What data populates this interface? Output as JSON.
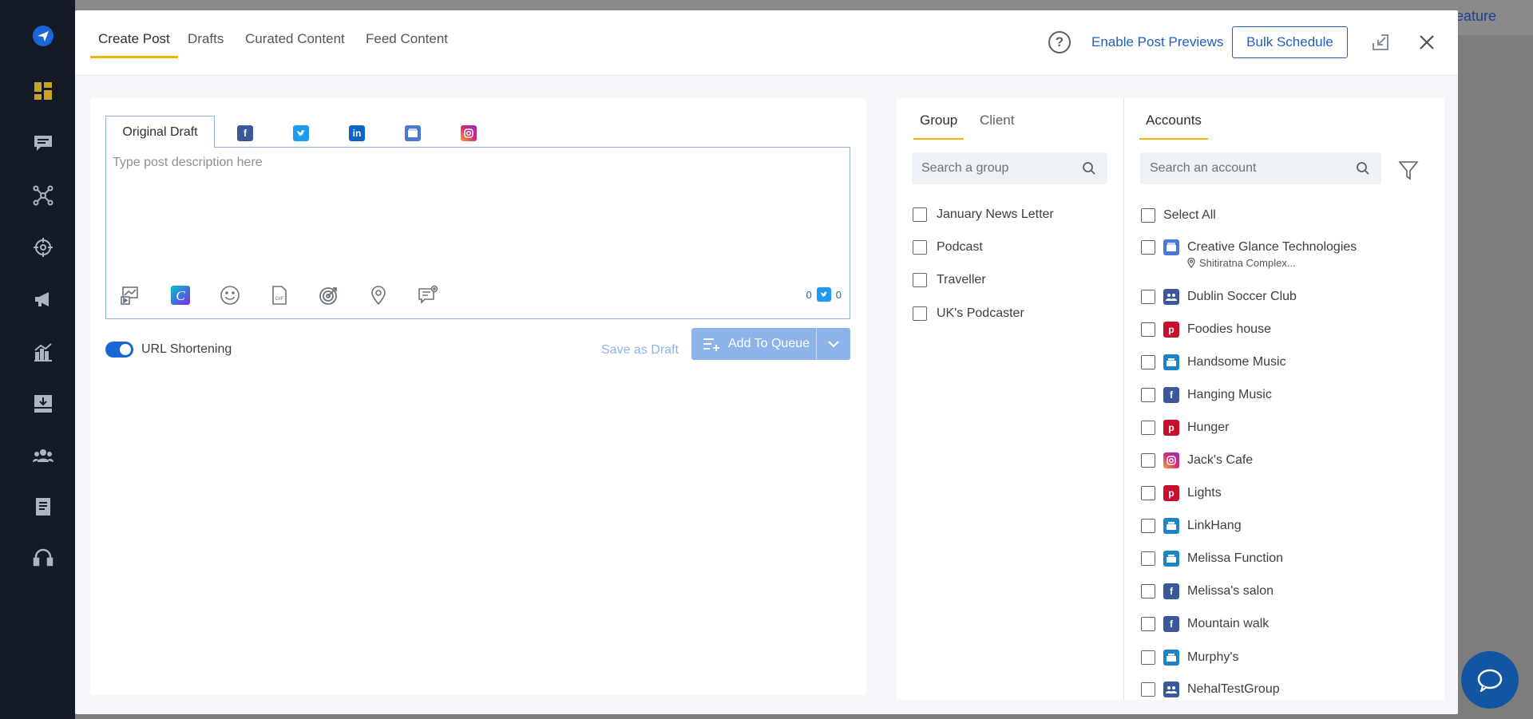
{
  "background": {
    "feature_text": "eature"
  },
  "header": {
    "tabs": [
      {
        "label": "Create Post"
      },
      {
        "label": "Drafts"
      },
      {
        "label": "Curated Content"
      },
      {
        "label": "Feed Content"
      }
    ],
    "help": "?",
    "enable_previews": "Enable Post Previews",
    "bulk_schedule": "Bulk Schedule"
  },
  "compose": {
    "original_tab": "Original Draft",
    "network_tabs": [
      "facebook-icon",
      "twitter-icon",
      "linkedin-icon",
      "google-business-icon",
      "instagram-icon"
    ],
    "placeholder": "Type post description here",
    "counter_left": "0",
    "counter_right": "0",
    "url_shortening": "URL Shortening",
    "save_draft": "Save as Draft",
    "add_to_queue": "Add To Queue"
  },
  "groups": {
    "tabs": [
      {
        "label": "Group"
      },
      {
        "label": "Client"
      }
    ],
    "search_placeholder": "Search a group",
    "items": [
      {
        "label": "January News Letter"
      },
      {
        "label": "Podcast"
      },
      {
        "label": "Traveller"
      },
      {
        "label": "UK's Podcaster"
      }
    ]
  },
  "accounts": {
    "tab": "Accounts",
    "search_placeholder": "Search an account",
    "select_all": "Select All",
    "items": [
      {
        "label": "Creative Glance Technologies",
        "sub": "Shitiratna Complex...",
        "network": "google-business",
        "color": "#4a78d6"
      },
      {
        "label": "Dublin Soccer Club",
        "network": "facebook-group",
        "color": "#3b5998"
      },
      {
        "label": "Foodies house",
        "network": "pinterest",
        "color": "#c8102e"
      },
      {
        "label": "Handsome Music",
        "network": "linkedin-page",
        "color": "#1a86c8"
      },
      {
        "label": "Hanging Music",
        "network": "facebook",
        "color": "#3b5998"
      },
      {
        "label": "Hunger",
        "network": "pinterest",
        "color": "#c8102e"
      },
      {
        "label": "Jack's Cafe",
        "network": "instagram",
        "color": "#d62976"
      },
      {
        "label": "Lights",
        "network": "pinterest",
        "color": "#c8102e"
      },
      {
        "label": "LinkHang",
        "network": "linkedin-page",
        "color": "#1a86c8"
      },
      {
        "label": "Melissa Function",
        "network": "linkedin-page",
        "color": "#1a86c8"
      },
      {
        "label": "Melissa's salon",
        "network": "facebook",
        "color": "#3b5998"
      },
      {
        "label": "Mountain walk",
        "network": "facebook",
        "color": "#3b5998"
      },
      {
        "label": "Murphy's",
        "network": "linkedin-page",
        "color": "#1a86c8"
      },
      {
        "label": "NehalTestGroup",
        "network": "facebook-group",
        "color": "#3b5998"
      }
    ]
  }
}
